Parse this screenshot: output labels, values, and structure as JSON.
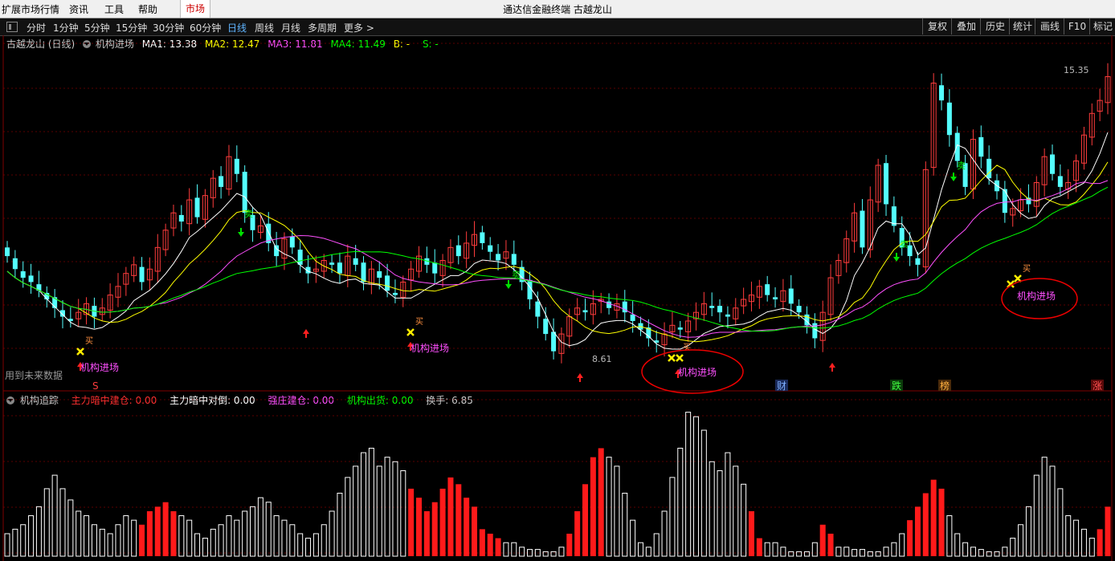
{
  "menubar": {
    "items": [
      "扩展市场行情",
      "资讯",
      "工具",
      "帮助"
    ],
    "market": "市场",
    "window_title": "通达信金融终端 古越龙山"
  },
  "toolbar": {
    "periods": [
      "分时",
      "1分钟",
      "5分钟",
      "15分钟",
      "30分钟",
      "60分钟",
      "日线",
      "周线",
      "月线",
      "多周期",
      "更多 >"
    ],
    "active_period": "日线",
    "right_buttons": [
      "复权",
      "叠加",
      "历史",
      "统计",
      "画线",
      "F10",
      "标记"
    ]
  },
  "info": {
    "stock": "古越龙山 (日线)",
    "indicator": "机构进场",
    "ma1": "MA1: 13.38",
    "ma2": "MA2: 12.47",
    "ma3": "MA3: 11.81",
    "ma4": "MA4: 11.49",
    "b": "B: -",
    "s": "S: -"
  },
  "sub_info": {
    "name": "机构追踪",
    "a": "主力暗中建仓: 0.00",
    "b": "主力暗中对倒: 0.00",
    "c": "强庄建仓: 0.00",
    "d": "机构出货: 0.00",
    "e": "换手: 6.85"
  },
  "chart_data": [
    {
      "type": "candlestick",
      "series": [
        "MA1",
        "MA2",
        "MA3",
        "MA4"
      ],
      "high_label": "15.35",
      "low_label": "8.61",
      "signal_text": "机构进场",
      "buy_mark": "买",
      "sell_mark": "卖",
      "footnote": "用到未来数据",
      "event_tags": [
        "S",
        "财",
        "跌",
        "榜",
        "涨"
      ],
      "colors": {
        "up": "#ff3c3c",
        "down": "#54ffff",
        "ma1": "#ffffff",
        "ma2": "#ffff00",
        "ma3": "#ff50ff",
        "ma4": "#00ff00"
      },
      "closes": [
        11.2,
        10.9,
        10.7,
        10.6,
        10.4,
        10.2,
        10.0,
        9.8,
        9.7,
        9.9,
        10.1,
        9.8,
        10.0,
        10.3,
        10.5,
        10.8,
        11.0,
        10.6,
        10.9,
        11.4,
        11.8,
        12.2,
        12.0,
        12.5,
        12.1,
        12.6,
        13.0,
        12.8,
        13.5,
        13.1,
        12.2,
        11.8,
        11.9,
        11.5,
        11.2,
        11.6,
        11.4,
        11.0,
        10.8,
        10.9,
        11.1,
        11.0,
        10.8,
        11.2,
        11.0,
        10.6,
        10.9,
        10.7,
        10.4,
        10.3,
        10.6,
        10.9,
        11.2,
        11.0,
        10.8,
        11.1,
        11.4,
        11.2,
        11.5,
        11.7,
        11.5,
        11.3,
        11.1,
        11.3,
        11.0,
        10.6,
        10.2,
        9.8,
        9.4,
        9.0,
        9.4,
        9.8,
        10.0,
        9.9,
        10.1,
        10.2,
        10.0,
        10.1,
        9.9,
        9.7,
        9.5,
        9.3,
        9.2,
        9.4,
        9.6,
        9.5,
        9.7,
        9.9,
        10.1,
        10.0,
        9.9,
        9.8,
        10.0,
        10.2,
        10.3,
        10.5,
        10.3,
        10.2,
        10.4,
        10.1,
        9.9,
        9.6,
        9.3,
        9.9,
        10.7,
        11.1,
        11.6,
        12.2,
        11.4,
        12.5,
        13.3,
        12.4,
        11.9,
        11.4,
        11.2,
        11.0,
        13.2,
        15.2,
        14.8,
        14.0,
        13.4,
        12.8,
        13.9,
        13.5,
        13.0,
        12.7,
        12.2,
        12.3,
        12.5,
        12.4,
        12.9,
        13.5,
        13.1,
        12.8,
        12.9,
        13.4,
        14.0,
        14.5,
        14.8,
        15.35
      ],
      "volume": [
        10,
        12,
        14,
        18,
        22,
        30,
        36,
        30,
        25,
        20,
        18,
        14,
        12,
        10,
        14,
        18,
        16,
        14,
        20,
        22,
        24,
        20,
        18,
        16,
        10,
        8,
        12,
        14,
        18,
        16,
        20,
        22,
        26,
        24,
        18,
        16,
        14,
        10,
        8,
        10,
        14,
        20,
        28,
        35,
        40,
        46,
        48,
        40,
        44,
        42,
        38,
        30,
        26,
        20,
        24,
        30,
        35,
        32,
        26,
        22,
        12,
        10,
        8,
        6,
        6,
        4,
        3,
        3,
        2,
        2,
        4,
        10,
        20,
        32,
        44,
        48,
        44,
        40,
        28,
        16,
        6,
        4,
        10,
        20,
        35,
        48,
        64,
        62,
        56,
        42,
        38,
        46,
        40,
        32,
        20,
        8,
        6,
        6,
        4,
        2,
        2,
        2,
        6,
        14,
        10,
        4,
        4,
        3,
        3,
        2,
        2,
        4,
        6,
        10,
        16,
        22,
        28,
        34,
        30,
        18,
        10,
        6,
        4,
        3,
        2,
        2,
        4,
        8,
        14,
        22,
        36,
        44,
        40,
        30,
        18,
        16,
        12,
        8,
        12,
        22,
        4,
        2
      ]
    },
    {
      "type": "bar",
      "series": [
        "机构追踪"
      ],
      "note": "volume bars; red where 机构进场 accumulation"
    }
  ]
}
